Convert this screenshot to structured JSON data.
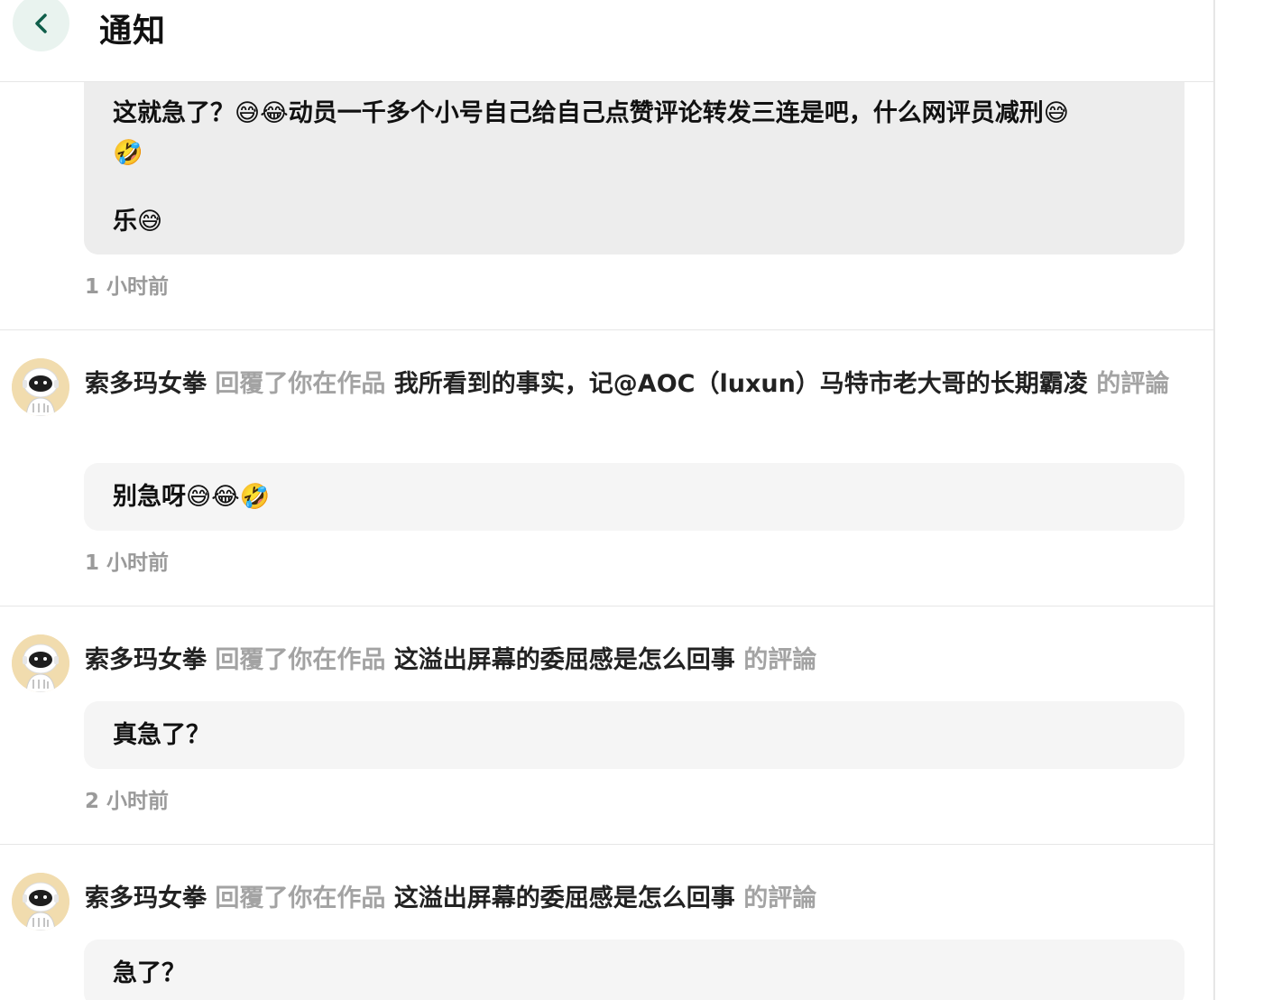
{
  "header": {
    "title": "通知"
  },
  "items": [
    {
      "bubble_lines": [
        "这就急了？😅😂动员一千多个小号自己给自己点赞评论转发三连是吧，什么网评员减刑😅",
        "🤣",
        "",
        "乐😅"
      ],
      "time": "1 小时前"
    },
    {
      "user": "索多玛女拳",
      "action": "回覆了你在作品",
      "work": "我所看到的事实，记@AOC（luxun）马特市老大哥的长期霸凌",
      "suffix": "的評論",
      "bubble": "别急呀😅😂🤣",
      "time": "1 小时前"
    },
    {
      "user": "索多玛女拳",
      "action": "回覆了你在作品",
      "work": "这溢出屏幕的委屈感是怎么回事",
      "suffix": "的評論",
      "bubble": "真急了？",
      "time": "2 小时前"
    },
    {
      "user": "索多玛女拳",
      "action": "回覆了你在作品",
      "work": "这溢出屏幕的委屈感是怎么回事",
      "suffix": "的評論",
      "bubble": "急了？"
    }
  ]
}
